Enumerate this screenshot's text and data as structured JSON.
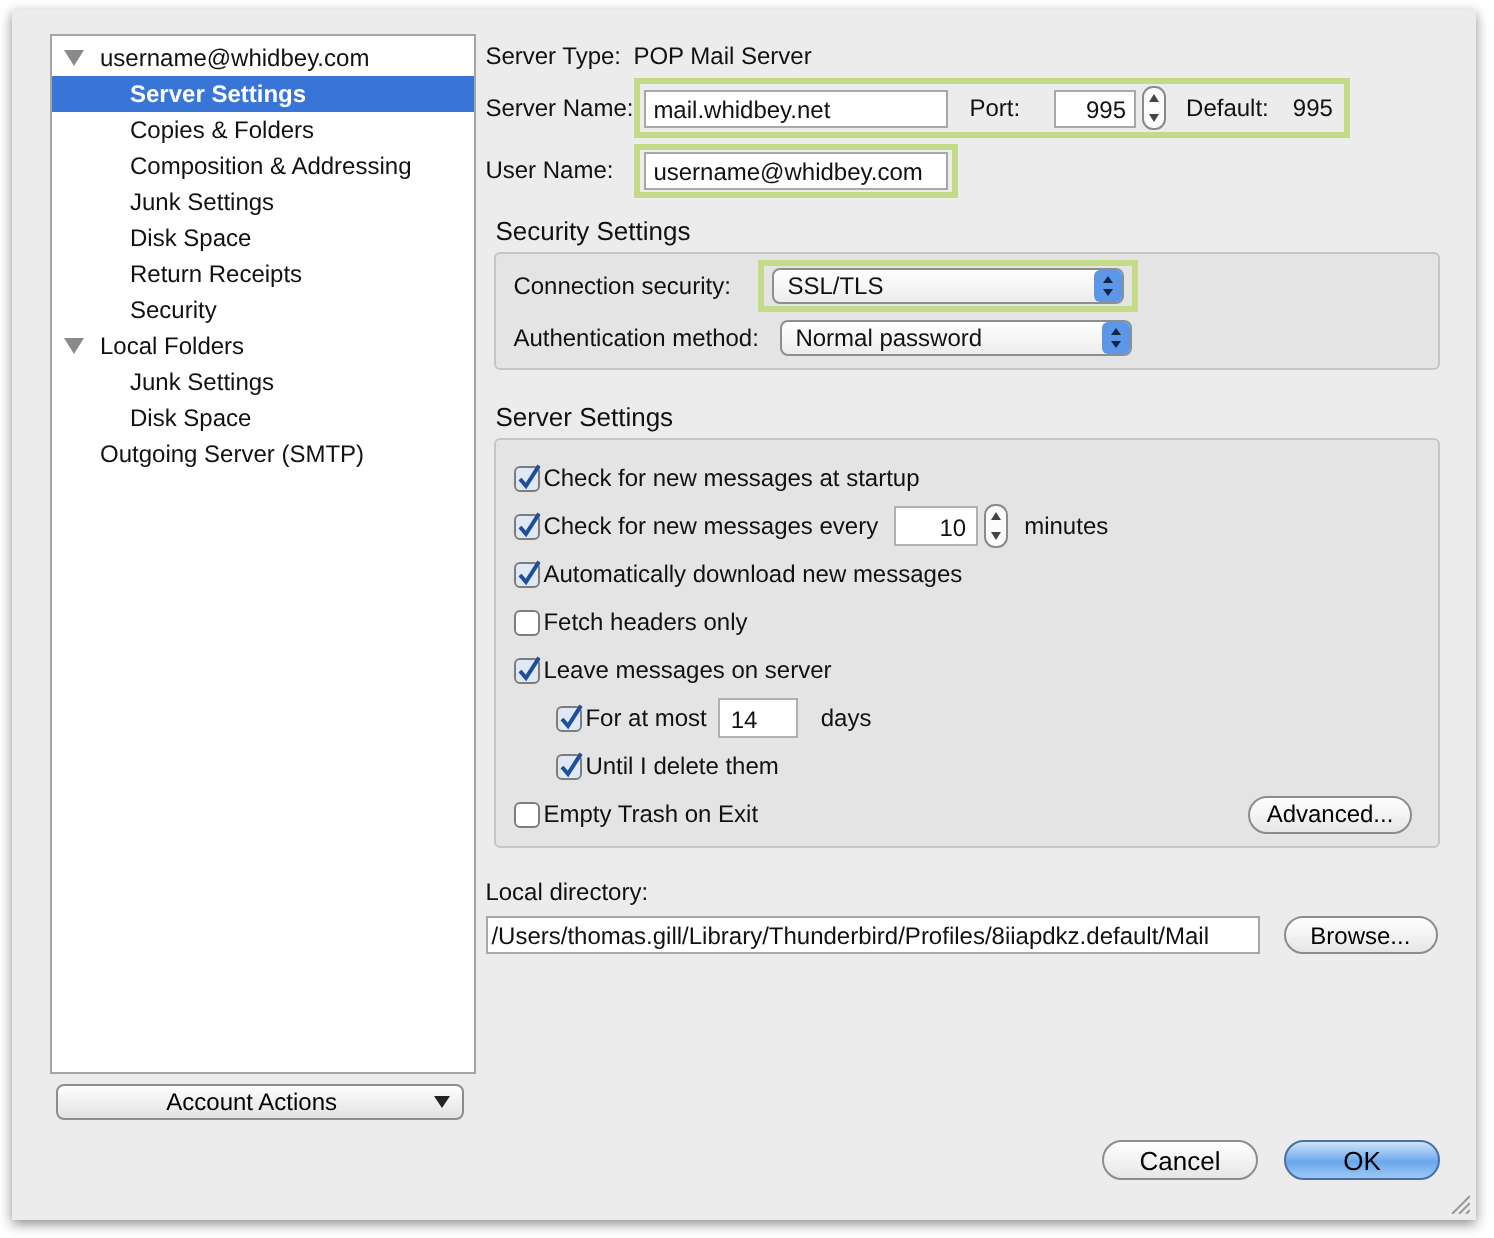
{
  "sidebar": {
    "items": [
      {
        "label": "username@whidbey.com",
        "expanded": true,
        "selected": false,
        "children": [
          {
            "label": "Server Settings",
            "selected": true
          },
          {
            "label": "Copies & Folders",
            "selected": false
          },
          {
            "label": "Composition & Addressing",
            "selected": false
          },
          {
            "label": "Junk Settings",
            "selected": false
          },
          {
            "label": "Disk Space",
            "selected": false
          },
          {
            "label": "Return Receipts",
            "selected": false
          },
          {
            "label": "Security",
            "selected": false
          }
        ]
      },
      {
        "label": "Local Folders",
        "expanded": true,
        "selected": false,
        "children": [
          {
            "label": "Junk Settings",
            "selected": false
          },
          {
            "label": "Disk Space",
            "selected": false
          }
        ]
      },
      {
        "label": "Outgoing Server (SMTP)",
        "selected": false
      }
    ],
    "account_actions": "Account Actions"
  },
  "server_type": {
    "label": "Server Type:",
    "value": "POP Mail Server"
  },
  "server_row": {
    "highlighted": true,
    "label": "Server Name:",
    "value": "mail.whidbey.net",
    "port_label": "Port:",
    "port": "995",
    "default_label": "Default:",
    "default": "995"
  },
  "user_row": {
    "highlighted": true,
    "label": "User Name:",
    "value": "username@whidbey.com"
  },
  "security_settings": {
    "title": "Security Settings",
    "rows": [
      {
        "label": "Connection security:",
        "value": "SSL/TLS",
        "highlighted": true
      },
      {
        "label": "Authentication method:",
        "value": "Normal password",
        "highlighted": false
      }
    ]
  },
  "server_settings": {
    "title": "Server Settings",
    "options": [
      {
        "kind": "check",
        "label": "Check for new messages at startup",
        "checked": true
      },
      {
        "kind": "interval",
        "label": "Check for new messages every",
        "checked": true,
        "value": "10",
        "unit": "minutes"
      },
      {
        "kind": "check",
        "label": "Automatically download new messages",
        "checked": true
      },
      {
        "kind": "check",
        "label": "Fetch headers only",
        "checked": false
      },
      {
        "kind": "check",
        "label": "Leave messages on server",
        "checked": true,
        "children": [
          {
            "kind": "days",
            "label": "For at most",
            "checked": true,
            "value": "14",
            "unit": "days"
          },
          {
            "kind": "check",
            "label": "Until I delete them",
            "checked": true
          }
        ]
      },
      {
        "kind": "check",
        "label": "Empty Trash on Exit",
        "checked": false,
        "button": "Advanced..."
      }
    ]
  },
  "local_directory": {
    "label": "Local directory:",
    "value": "/Users/thomas.gill/Library/Thunderbird/Profiles/8iiapdkz.default/Mail",
    "button": "Browse..."
  },
  "buttons": [
    {
      "label": "Cancel",
      "default": false
    },
    {
      "label": "OK",
      "default": true
    }
  ]
}
